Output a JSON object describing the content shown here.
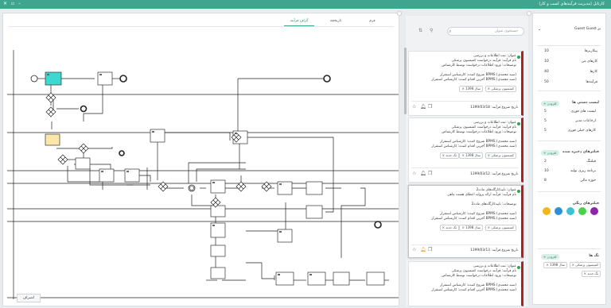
{
  "window": {
    "title": "کارتابل (مدیریت فرآیندهای کسب و کار)"
  },
  "filters": {
    "user": "Guest Guest پژ",
    "stats": [
      {
        "label": "پیکاربرها",
        "value": "10"
      },
      {
        "label": "کارهای من",
        "value": "10"
      },
      {
        "label": "کارها",
        "value": "40"
      },
      {
        "label": "فرآیندها",
        "value": "50"
      }
    ],
    "recent_title": "لیست دستی ها",
    "recent_add": "افزودن",
    "recent_items": [
      {
        "label": "لیست های فوری",
        "value": "5"
      },
      {
        "label": "ارجاعات مدیر",
        "value": "5"
      },
      {
        "label": "کارهای خیلی فوری",
        "value": "5"
      }
    ],
    "saved_title": "فیلترهای ذخیره شده",
    "saved_add": "افزودن",
    "saved_items": [
      {
        "label": "فیلتنگ",
        "value": "2"
      },
      {
        "label": "برنامه ریزی تولید",
        "value": "10"
      },
      {
        "label": "حوزه مالی",
        "value": "8"
      }
    ],
    "color_title": "فیلترهای رنگی",
    "colors": [
      "#f5b51b",
      "#2d8fd5",
      "#3ec1d3",
      "#4bd14b",
      "#8e24aa"
    ],
    "tags_title": "تگ ها",
    "tags_add": "افزودن",
    "tags": [
      "کمیسیون پزشکی",
      "سال 1398",
      "تگ جدید"
    ]
  },
  "list": {
    "search_placeholder": "جستجوی عنوان",
    "cards": [
      {
        "title": "عنوان: ثبت اطلاعات و بررسی",
        "process": "نام فرآیند: فرآیند درخواست کمیسیون پزشکی",
        "desc": "توضیحات: ورود اطلاعات درخواست توسط کارشناس",
        "starter": "شروع کننده: کارشناس استقرار BPMS (سید محمدی)",
        "last": "آخرین اقدام کننده: کارشناس استقرار BPMS (سید محمدی)",
        "tags": [
          "کمیسیون پزشکی",
          "سال 1398"
        ],
        "date": "تاریخ شروع فرآیند: 1399/03/18"
      },
      {
        "title": "عنوان: ثبت اطلاعات و بررسی",
        "process": "نام فرآیند: فرآیند درخواست کمیسیون پزشکی",
        "desc": "توضیحات: ورود اطلاعات درخواست توسط کارشناس",
        "starter": "شروع کننده: کارشناس استقرار BPMS (سید محمدی)",
        "last": "آخرین اقدام کننده: کارشناس استقرار BPMS (سید محمدی)",
        "tags": [
          "کمیسیون پزشکی",
          "سال 1398",
          "تگ جدید"
        ],
        "date": "تاریخ شروع فرآیند: 1399/03/12"
      },
      {
        "title": "عنوان: تاییدکارگاه‌های ماده2",
        "process": "نام فرآیند: فرآیند ارائه پروانه اعطای هشت ماهی",
        "desc": "توضیحات: تاییدکارگاه‌های ماده2",
        "starter": "شروع کننده: کارشناس استقرار BPMS (سید محمدی)",
        "last": "آخرین اقدام کننده: کارشناس استقرار BPMS (سید محمدی)",
        "tags": [
          "کمیسیون پزشکی",
          "سال 1398",
          "تگ جدید"
        ],
        "date": "تاریخ شروع فرآیند: 1399/03/13"
      },
      {
        "title": "عنوان: ثبت اطلاعات و بررسی",
        "process": "نام فرآیند: فرآیند درخواست کمیسیون پزشکی",
        "desc": "توضیحات: ورود اطلاعات درخواست توسط کارشناس",
        "starter": "شروع کننده: کارشناس استقرار BPMS (سید محمدی)",
        "last": "آخرین اقدام کننده: کارشناس استقرار BPMS (سید محمدی)"
      }
    ]
  },
  "main": {
    "tabs": [
      "فرم",
      "تاریخچه",
      "گراف فرآیند"
    ],
    "active_tab": 2,
    "cancel_label": "انصراف"
  }
}
